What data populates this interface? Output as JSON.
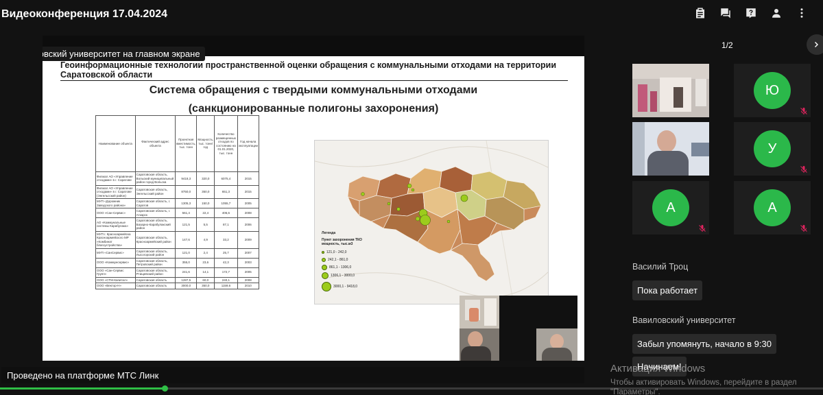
{
  "app": {
    "title": "Видеоконференция 17.04.2024"
  },
  "top_icons": [
    "clipboard-icon",
    "chat-icon",
    "help-icon",
    "person-icon",
    "more-vertical-icon"
  ],
  "presenter_badge": "Вавиловский университет на главном экране",
  "slide": {
    "header": "Геоинформационные технологии пространственной оценки обращения с коммунальными отходами на территории Саратовской области",
    "title_line1": "Система обращения с твердыми коммунальными отходами",
    "title_line2": "(санкционированные полигоны захоронения)",
    "table": {
      "headers": [
        "Наименование объекта",
        "Фактический адрес объекта",
        "Проектная вместимость, тыс. тонн",
        "Мощность, тыс. тонн/год",
        "Количество размещенных отходов по состоянию на 01.01.2020, тыс. тонн",
        "Год начала эксплуатации"
      ],
      "rows": [
        [
          "Филиал АО «Управление отходами» в г. Саратове",
          "Саратовская область, Вольский муниципальный район город Вольска",
          "9418,3",
          "320,0",
          "6075,4",
          "2015"
        ],
        [
          "Филиал АО «Управление отходами» в г. Саратове (Энгельсский район)",
          "Саратовская область, Энгельсский район",
          "8750,0",
          "350,0",
          "651,3",
          "2015"
        ],
        [
          "МУП «Дорожник Заводского района»",
          "Саратовская область, г. Саратов",
          "1305,3",
          "150,0",
          "1055,7",
          "2005"
        ],
        [
          "ООО «Сан-Сервис»",
          "Саратовская область, г. Аткарск",
          "561,4",
          "22,4",
          "406,6",
          "2008"
        ],
        [
          "АО «Коммунальные системы Карабулака»",
          "Саратовская область, Базарно-Карабулакский район",
          "121,5",
          "5,5",
          "87,1",
          "2006"
        ],
        [
          "МУП г. Красноармейска Красноармейского МР «Комбинат благоустройства»",
          "Саратовская область, Красноармейский район",
          "147,6",
          "4,9",
          "33,2",
          "2009"
        ],
        [
          "МУП «СанСервис»",
          "Саратовская область, Лысогорский район",
          "121,0",
          "2,4",
          "25,7",
          "2007"
        ],
        [
          "ООО «Коммунсервис»",
          "Саратовская область, Петровский район",
          "355,0",
          "23,6",
          "42,3",
          "2003"
        ],
        [
          "ООО «Сан-Сервис Групп»",
          "Саратовская область, Ртищевский район",
          "241,6",
          "14,1",
          "172,7",
          "2005"
        ],
        [
          "ООО «СТМ-Капитал»",
          "Саратовская область",
          "1287,5",
          "60,0",
          "240,1",
          "2008"
        ],
        [
          "ООО «Вектор-Н»",
          "Саратовская область",
          "3000,0",
          "350,0",
          "1159,6",
          "2010"
        ]
      ]
    },
    "map": {
      "legend_title": "Легенда",
      "legend_subtitle": "Пункт захоронения ТКО мощность, тыс.м3",
      "legend_items": [
        "121,0 - 242,0",
        "242,1 - 861,0",
        "861,1 - 1306,0",
        "1306,1 - 3000,0",
        "3000,1 - 9418,0"
      ]
    }
  },
  "bottom_label": "Проведено на платформе МТС Линк",
  "playback": {
    "progress_percent": 20
  },
  "page_indicator": "1/2",
  "participants": [
    {
      "type": "video",
      "initial": ""
    },
    {
      "type": "avatar",
      "initial": "Ю",
      "muted": true
    },
    {
      "type": "video",
      "initial": ""
    },
    {
      "type": "avatar",
      "initial": "У",
      "muted": true
    },
    {
      "type": "avatar",
      "initial": "А",
      "muted": true
    },
    {
      "type": "avatar",
      "initial": "А",
      "muted": true
    }
  ],
  "chat": [
    {
      "author": "Василий Троц",
      "messages": [
        "Пока работает"
      ]
    },
    {
      "author": "Вавиловский университет",
      "messages": [
        "Забыл упомянуть, начало в 9:30",
        "Начинаем!"
      ]
    }
  ],
  "watermark": {
    "title": "Активация Windows",
    "line1": "Чтобы активировать Windows, перейдите в раздел",
    "line2": "\"Параметры\"."
  },
  "colors": {
    "accent": "#2bb84a",
    "background": "#121212",
    "bubble": "#2a2a2a",
    "mic_off": "#e0245e"
  }
}
